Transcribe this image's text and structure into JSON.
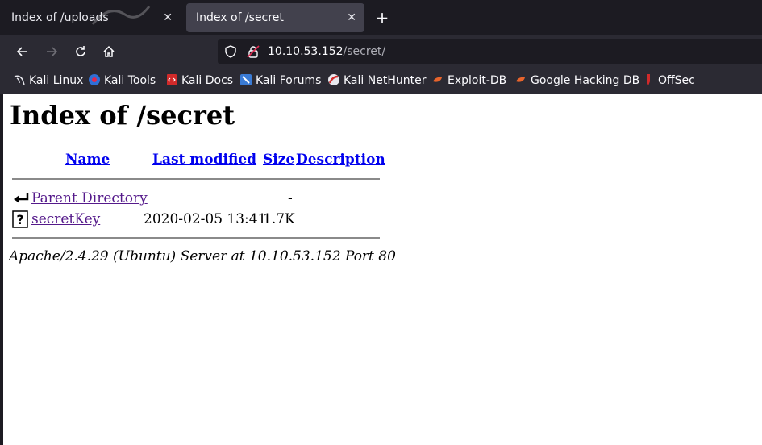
{
  "tabs": [
    {
      "label": "Index of /uploads",
      "close": "✕"
    },
    {
      "label": "Index of /secret",
      "close": "✕"
    }
  ],
  "new_tab": "+",
  "url": {
    "host": "10.10.53.152",
    "path": "/secret/"
  },
  "bookmarks": [
    "Kali Linux",
    "Kali Tools",
    "Kali Docs",
    "Kali Forums",
    "Kali NetHunter",
    "Exploit-DB",
    "Google Hacking DB",
    "OffSec"
  ],
  "page": {
    "title": "Index of /secret",
    "columns": {
      "name": "Name",
      "modified": "Last modified",
      "size": "Size",
      "description": "Description"
    },
    "rows": [
      {
        "name": "Parent Directory",
        "modified": "",
        "size": "-",
        "icon": "parent-directory-icon"
      },
      {
        "name": "secretKey",
        "modified": "2020-02-05 13:41",
        "size": "1.7K",
        "icon": "unknown-file-icon"
      }
    ],
    "footer": "Apache/2.4.29 (Ubuntu) Server at 10.10.53.152 Port 80"
  }
}
